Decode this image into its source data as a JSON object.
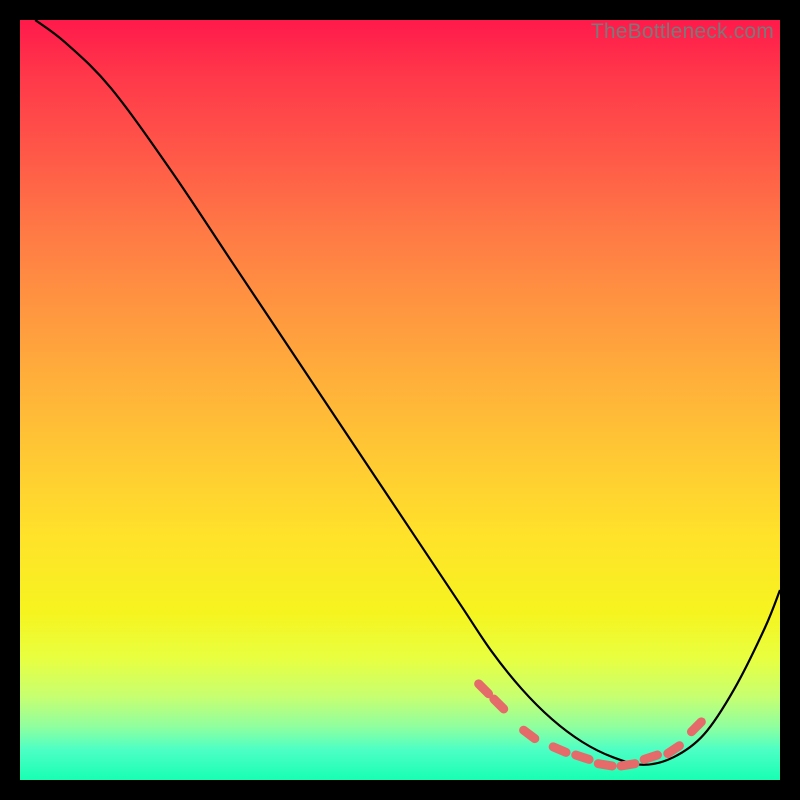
{
  "watermark": "TheBottleneck.com",
  "chart_data": {
    "type": "line",
    "title": "",
    "xlabel": "",
    "ylabel": "",
    "xlim": [
      0,
      100
    ],
    "ylim": [
      0,
      100
    ],
    "grid": false,
    "series": [
      {
        "name": "curve",
        "color": "#000000",
        "x": [
          2,
          6,
          12,
          20,
          28,
          36,
          44,
          52,
          58,
          62,
          66,
          70,
          74,
          78,
          82,
          86,
          90,
          94,
          98,
          100
        ],
        "y": [
          100,
          97,
          91,
          80,
          68,
          56,
          44,
          32,
          23,
          17,
          12,
          8,
          5,
          3,
          2,
          3,
          6,
          12,
          20,
          25
        ]
      }
    ],
    "markers": {
      "name": "bottleneck-markers",
      "color": "#e56a6a",
      "x": [
        61,
        63,
        67,
        71,
        74,
        77,
        80,
        83,
        86,
        89
      ],
      "y": [
        12,
        10,
        6,
        4,
        3,
        2,
        2,
        3,
        4,
        7
      ]
    }
  }
}
